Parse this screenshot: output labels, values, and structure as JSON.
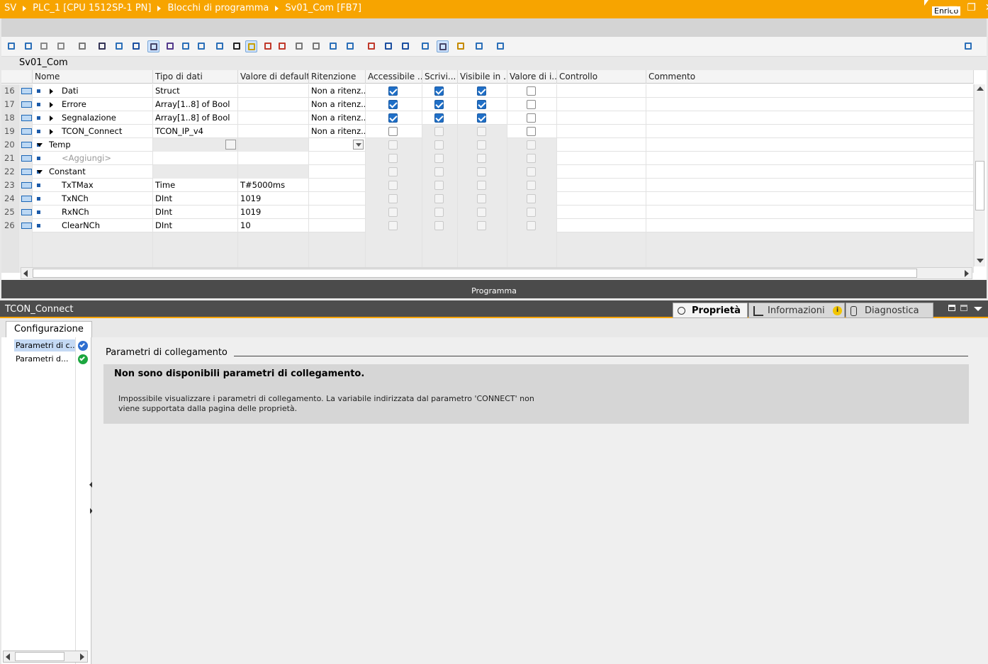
{
  "titlebar": {
    "crumbs": [
      "SV",
      "PLC_1 [CPU 1512SP-1 PN]",
      "Blocchi di programma",
      "Sv01_Com [FB7]"
    ],
    "user": "Enrico",
    "accent": "#f7a400"
  },
  "editor": {
    "block_name": "Sv01_Com",
    "columns": [
      "Nome",
      "Tipo di dati",
      "Valore di default",
      "Ritenzione",
      "Accessibile ...",
      "Scrivi...",
      "Visibile in ..",
      "Valore di i..",
      "Controllo",
      "Commento"
    ],
    "rows": [
      {
        "num": "16",
        "name": "Dati",
        "type": "Struct",
        "default": "",
        "retain": "Non a ritenz...",
        "checks": [
          1,
          1,
          1,
          0
        ],
        "expand": "r",
        "indent": 1
      },
      {
        "num": "17",
        "name": "Errore",
        "type": "Array[1..8] of Bool",
        "default": "",
        "retain": "Non a ritenz...",
        "checks": [
          1,
          1,
          1,
          0
        ],
        "expand": "r",
        "indent": 1
      },
      {
        "num": "18",
        "name": "Segnalazione",
        "type": "Array[1..8] of Bool",
        "default": "",
        "retain": "Non a ritenz...",
        "checks": [
          1,
          1,
          1,
          0
        ],
        "expand": "r",
        "indent": 1
      },
      {
        "num": "19",
        "name": "TCON_Connect",
        "type": "TCON_IP_v4",
        "default": "",
        "retain": "Non a ritenz...",
        "checks": [
          0,
          2,
          2,
          0
        ],
        "expand": "r",
        "indent": 1
      },
      {
        "num": "20",
        "name": "Temp",
        "type": "",
        "default": "",
        "retain": "",
        "checks": [
          2,
          2,
          2,
          2
        ],
        "expand": "d",
        "indent": 0,
        "section": true
      },
      {
        "num": "21",
        "name": "<Aggiungi>",
        "type": "",
        "default": "",
        "retain": "",
        "checks": [
          2,
          2,
          2,
          2
        ],
        "expand": "",
        "indent": 2,
        "placeholder": true
      },
      {
        "num": "22",
        "name": "Constant",
        "type": "",
        "default": "",
        "retain": "",
        "checks": [
          2,
          2,
          2,
          2
        ],
        "expand": "d",
        "indent": 0,
        "section": true
      },
      {
        "num": "23",
        "name": "TxTMax",
        "type": "Time",
        "default": "T#5000ms",
        "retain": "",
        "checks": [
          2,
          2,
          2,
          2
        ],
        "expand": "",
        "indent": 2
      },
      {
        "num": "24",
        "name": "TxNCh",
        "type": "DInt",
        "default": "1019",
        "retain": "",
        "checks": [
          2,
          2,
          2,
          2
        ],
        "expand": "",
        "indent": 2
      },
      {
        "num": "25",
        "name": "RxNCh",
        "type": "DInt",
        "default": "1019",
        "retain": "",
        "checks": [
          2,
          2,
          2,
          2
        ],
        "expand": "",
        "indent": 2
      },
      {
        "num": "26",
        "name": "ClearNCh",
        "type": "DInt",
        "default": "10",
        "retain": "",
        "checks": [
          2,
          2,
          2,
          2
        ],
        "expand": "",
        "indent": 2
      }
    ],
    "splitter_label": "Programma"
  },
  "inspector": {
    "title": "TCON_Connect",
    "tabs": [
      {
        "label": "Proprietà",
        "icon": "properties-icon"
      },
      {
        "label": "Informazioni",
        "icon": "info-icon"
      },
      {
        "label": "Diagnostica",
        "icon": "diagnostics-icon"
      }
    ],
    "config_tab": "Configurazione",
    "nav_items": [
      "Parametri di c...",
      "Parametri d..."
    ],
    "section_title": "Parametri di collegamento",
    "message_title": "Non sono disponibili parametri di collegamento.",
    "message_body": "Impossibile visualizzare i parametri di collegamento. La variabile indirizzata dal parametro 'CONNECT' non viene supportata dalla pagina delle proprietà."
  }
}
